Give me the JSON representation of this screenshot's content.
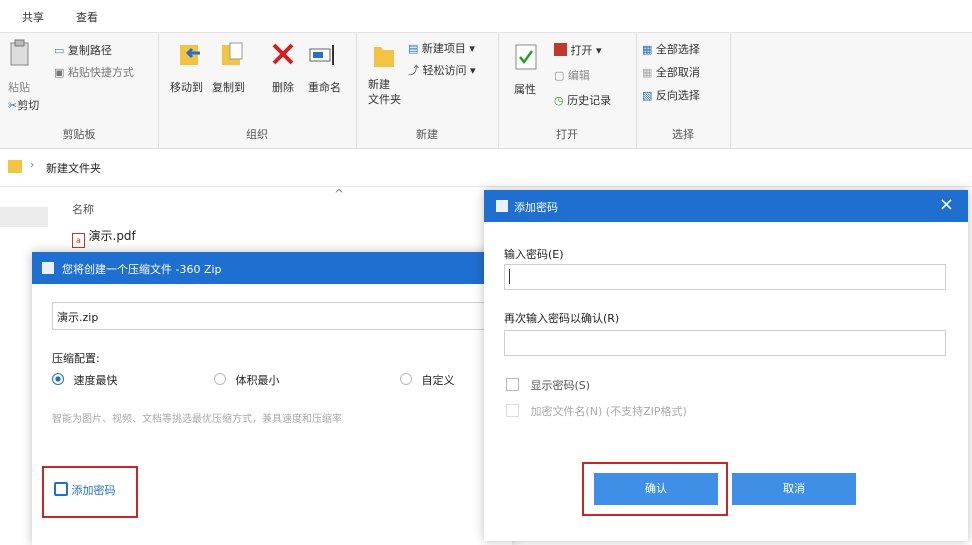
{
  "ribbon_tabs": [
    "共享",
    "查看"
  ],
  "ribbon": {
    "clipboard": {
      "paste": "粘贴",
      "copy_path": "复制路径",
      "paste_shortcut": "粘贴快捷方式",
      "cut": "剪切",
      "group": "剪贴板"
    },
    "organize": {
      "move_to": "移动到",
      "copy_to": "复制到",
      "delete": "删除",
      "rename": "重命名",
      "group": "组织"
    },
    "new": {
      "new_folder": "新建\n文件夹",
      "new_item": "新建项目 ▾",
      "easy_access": "轻松访问 ▾",
      "group": "新建"
    },
    "open": {
      "properties": "属性",
      "open": "打开 ▾",
      "edit": "编辑",
      "history": "历史记录",
      "group": "打开"
    },
    "select": {
      "select_all": "全部选择",
      "select_none": "全部取消",
      "invert": "反向选择",
      "group": "选择"
    }
  },
  "address": {
    "separator": "›",
    "path": "新建文件夹"
  },
  "file_list": {
    "column_name": "名称",
    "sort_arrow": "^",
    "file": "演示.pdf"
  },
  "zip_dialog": {
    "title": "您将创建一个压缩文件 -360 Zip",
    "filename": "演示.zip",
    "config_label": "压缩配置:",
    "options": [
      "速度最快",
      "体积最小",
      "自定义"
    ],
    "hint": "智能为图片、视频、文档等挑选最优压缩方式，兼具速度和压缩率",
    "add_password": "添加密码"
  },
  "pwd_dialog": {
    "title": "添加密码",
    "close": "×",
    "enter_label": "输入密码(E)",
    "enter_value": "",
    "confirm_label": "再次输入密码以确认(R)",
    "confirm_value": "",
    "show_password": "显示密码(S)",
    "encrypt_names": "加密文件名(N) (不支持ZIP格式)",
    "ok": "确认",
    "cancel": "取消"
  },
  "colors": {
    "accent": "#1e6fd0",
    "button": "#3f8fe6",
    "highlight_box": "#c62828"
  }
}
